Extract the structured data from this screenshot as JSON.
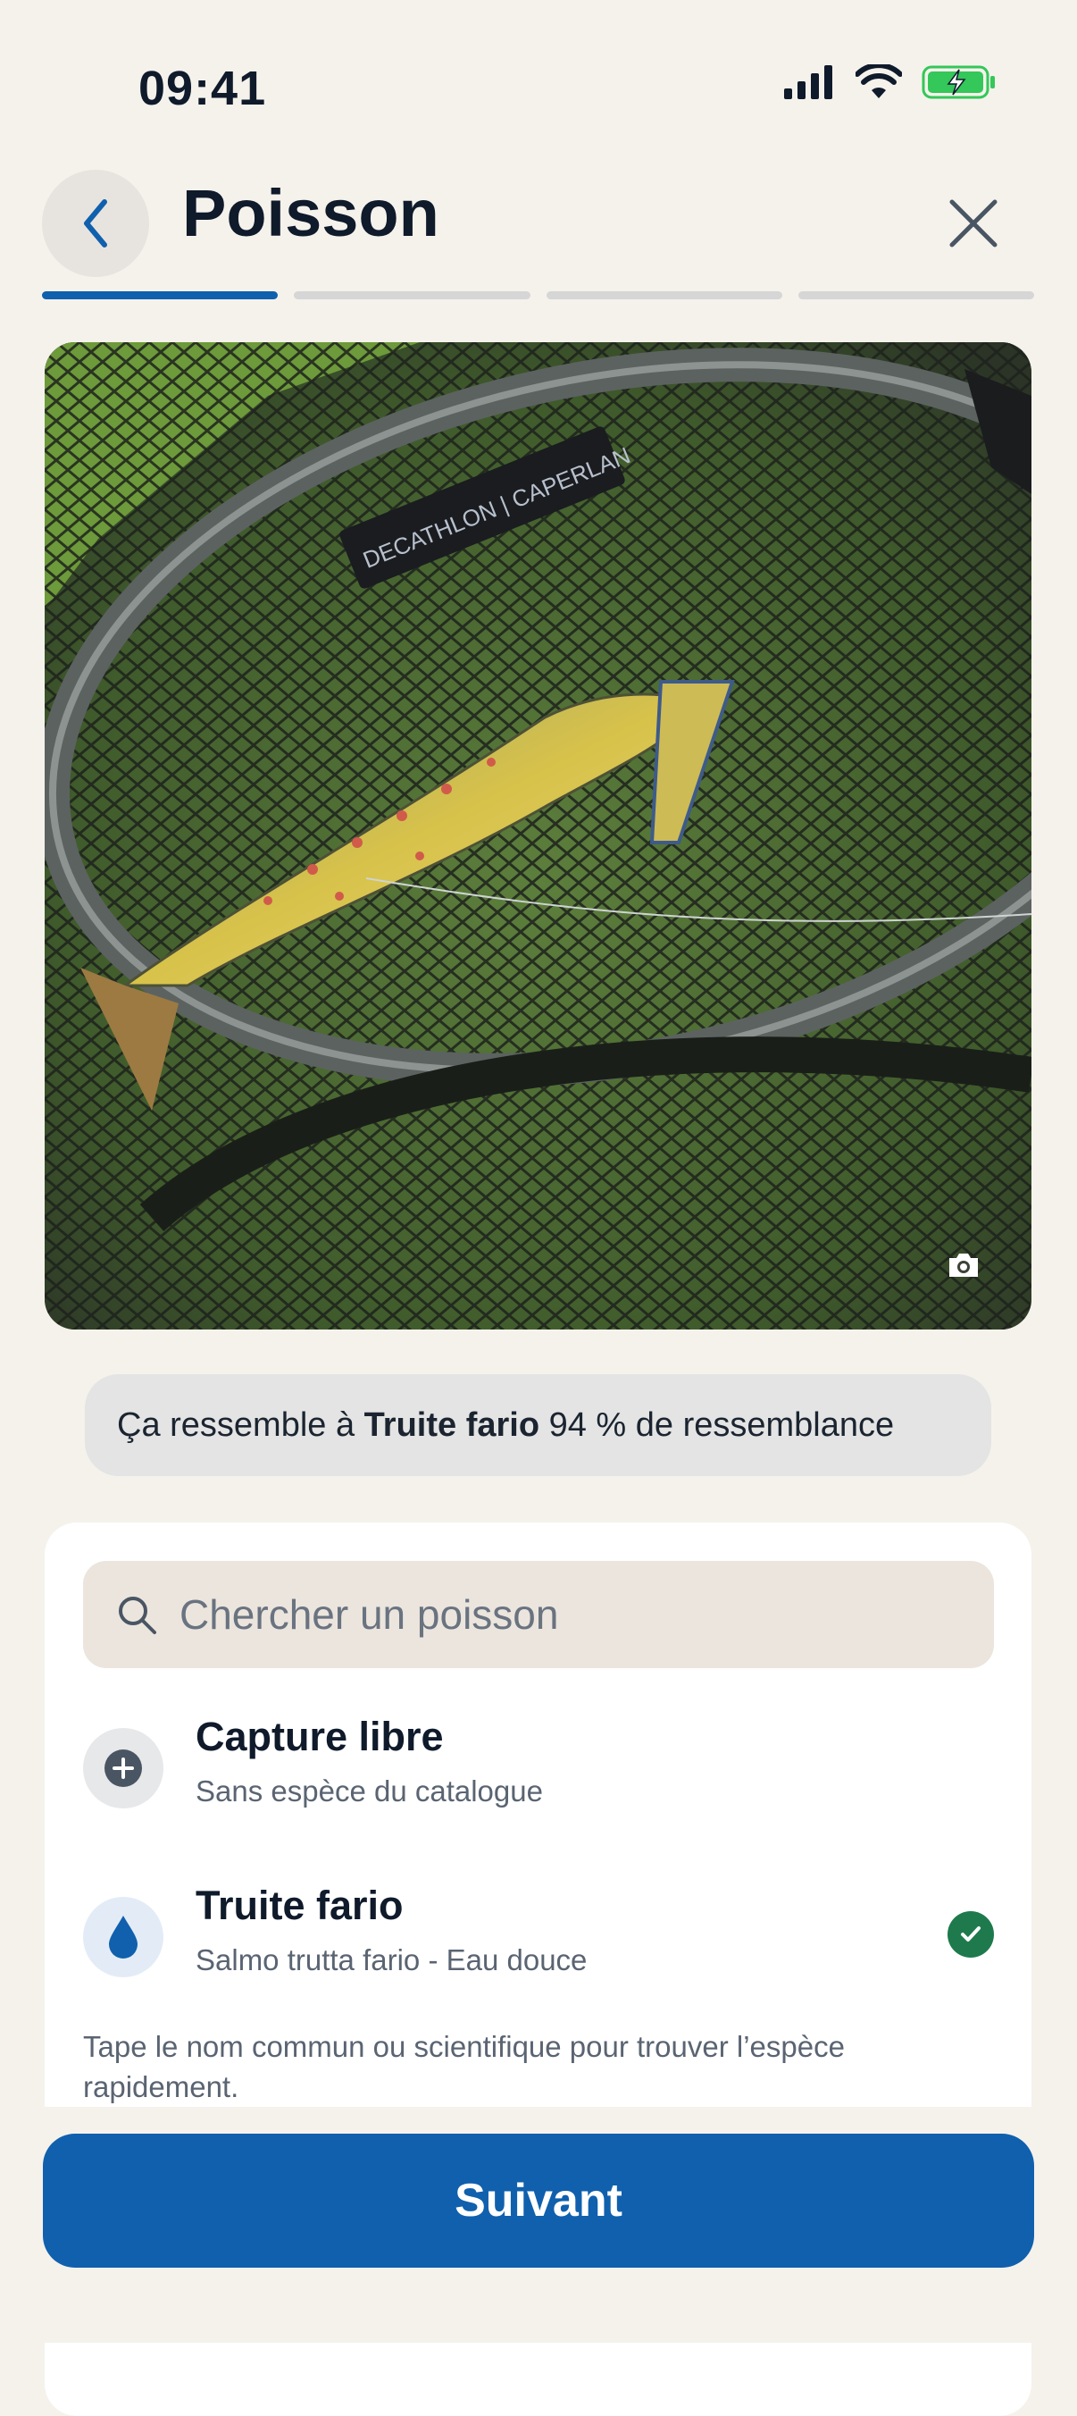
{
  "status_bar": {
    "time": "09:41"
  },
  "header": {
    "title": "Poisson",
    "steps_total": 4,
    "current_step": 1
  },
  "suggestion": {
    "prefix": "Ça ressemble à ",
    "species": "Truite fario",
    "suffix": " 94 % de ressemblance"
  },
  "search": {
    "placeholder": "Chercher un poisson"
  },
  "options": [
    {
      "title": "Capture libre",
      "subtitle": "Sans espèce du catalogue",
      "icon": "plus-circle-icon",
      "selected": false
    },
    {
      "title": "Truite fario",
      "subtitle": "Salmo trutta fario - Eau douce",
      "icon": "water-drop-icon",
      "selected": true
    }
  ],
  "hint": "Tape le nom commun ou scientifique pour trouver l’espèce rapidement.",
  "photo": {
    "label_text": "DECATHLON | CAPERLAN"
  },
  "footer": {
    "next_label": "Suivant"
  },
  "colors": {
    "accent": "#1060ad",
    "success": "#1e7a4c",
    "background": "#f5f2ec"
  }
}
